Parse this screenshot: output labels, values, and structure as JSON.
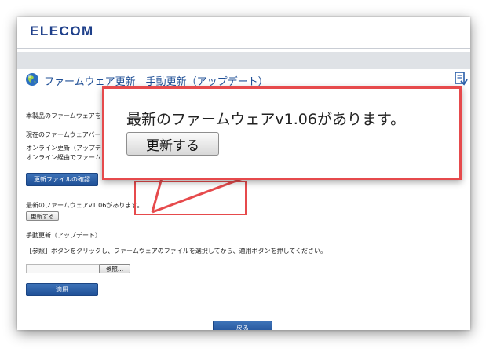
{
  "brand": {
    "logo_text": "ELECOM"
  },
  "page": {
    "title": "ファームウェア更新　手動更新（アップデート）"
  },
  "content": {
    "intro": "本製品のファームウェアを",
    "current_version_label": "現在のファームウェアバー",
    "online_update_line1": "オンライン更新（アップデ",
    "online_update_line2": "オンライン経由でファーム",
    "check_file_button": "更新ファイルの確認",
    "new_firmware_message": "最新のファームウェアv1.06があります。",
    "update_button": "更新する",
    "manual_update_heading": "手動更新（アップデート）",
    "manual_update_instruction": "【参照】ボタンをクリックし、ファームウェアのファイルを選択してから、適用ボタンを押してください。",
    "browse_button": "参照...",
    "apply_button": "適用",
    "back_button": "戻る"
  },
  "callout": {
    "message": "最新のファームウェアv1.06があります。",
    "button": "更新する"
  },
  "colors": {
    "brand_blue": "#1e3f8a",
    "accent_blue": "#1f4f96",
    "highlight_red": "#e64a4c"
  },
  "icons": {
    "title_icon": "globe-icon",
    "help_icon": "help-icon"
  }
}
